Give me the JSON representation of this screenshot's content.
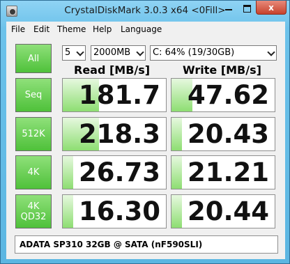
{
  "window": {
    "title": "CrystalDiskMark 3.0.3 x64 <0Fill>",
    "minimize": "",
    "maximize": "",
    "close": "x"
  },
  "menu": [
    "File",
    "Edit",
    "Theme",
    "Help",
    "Language"
  ],
  "controls": {
    "all_label": "All",
    "count": "5",
    "size": "2000MB",
    "drive": "C: 64% (19/30GB)"
  },
  "headers": {
    "read": "Read [MB/s]",
    "write": "Write [MB/s]"
  },
  "tests": [
    {
      "label": "Seq",
      "read": "181.7",
      "write": "47.62",
      "read_fill": 0.35,
      "write_fill": 0.2
    },
    {
      "label": "512K",
      "read": "218.3",
      "write": "20.43",
      "read_fill": 0.35,
      "write_fill": 0.1
    },
    {
      "label": "4K",
      "read": "26.73",
      "write": "21.21",
      "read_fill": 0.1,
      "write_fill": 0.1
    },
    {
      "label_line1": "4K",
      "label_line2": "QD32",
      "read": "16.30",
      "write": "20.44",
      "read_fill": 0.1,
      "write_fill": 0.1
    }
  ],
  "comment": "ADATA SP310 32GB @ SATA (nF590SLI)",
  "colors": {
    "accent": "#4fc13a",
    "bar": "#8ede72",
    "titlebar": "#6cc2ea"
  }
}
